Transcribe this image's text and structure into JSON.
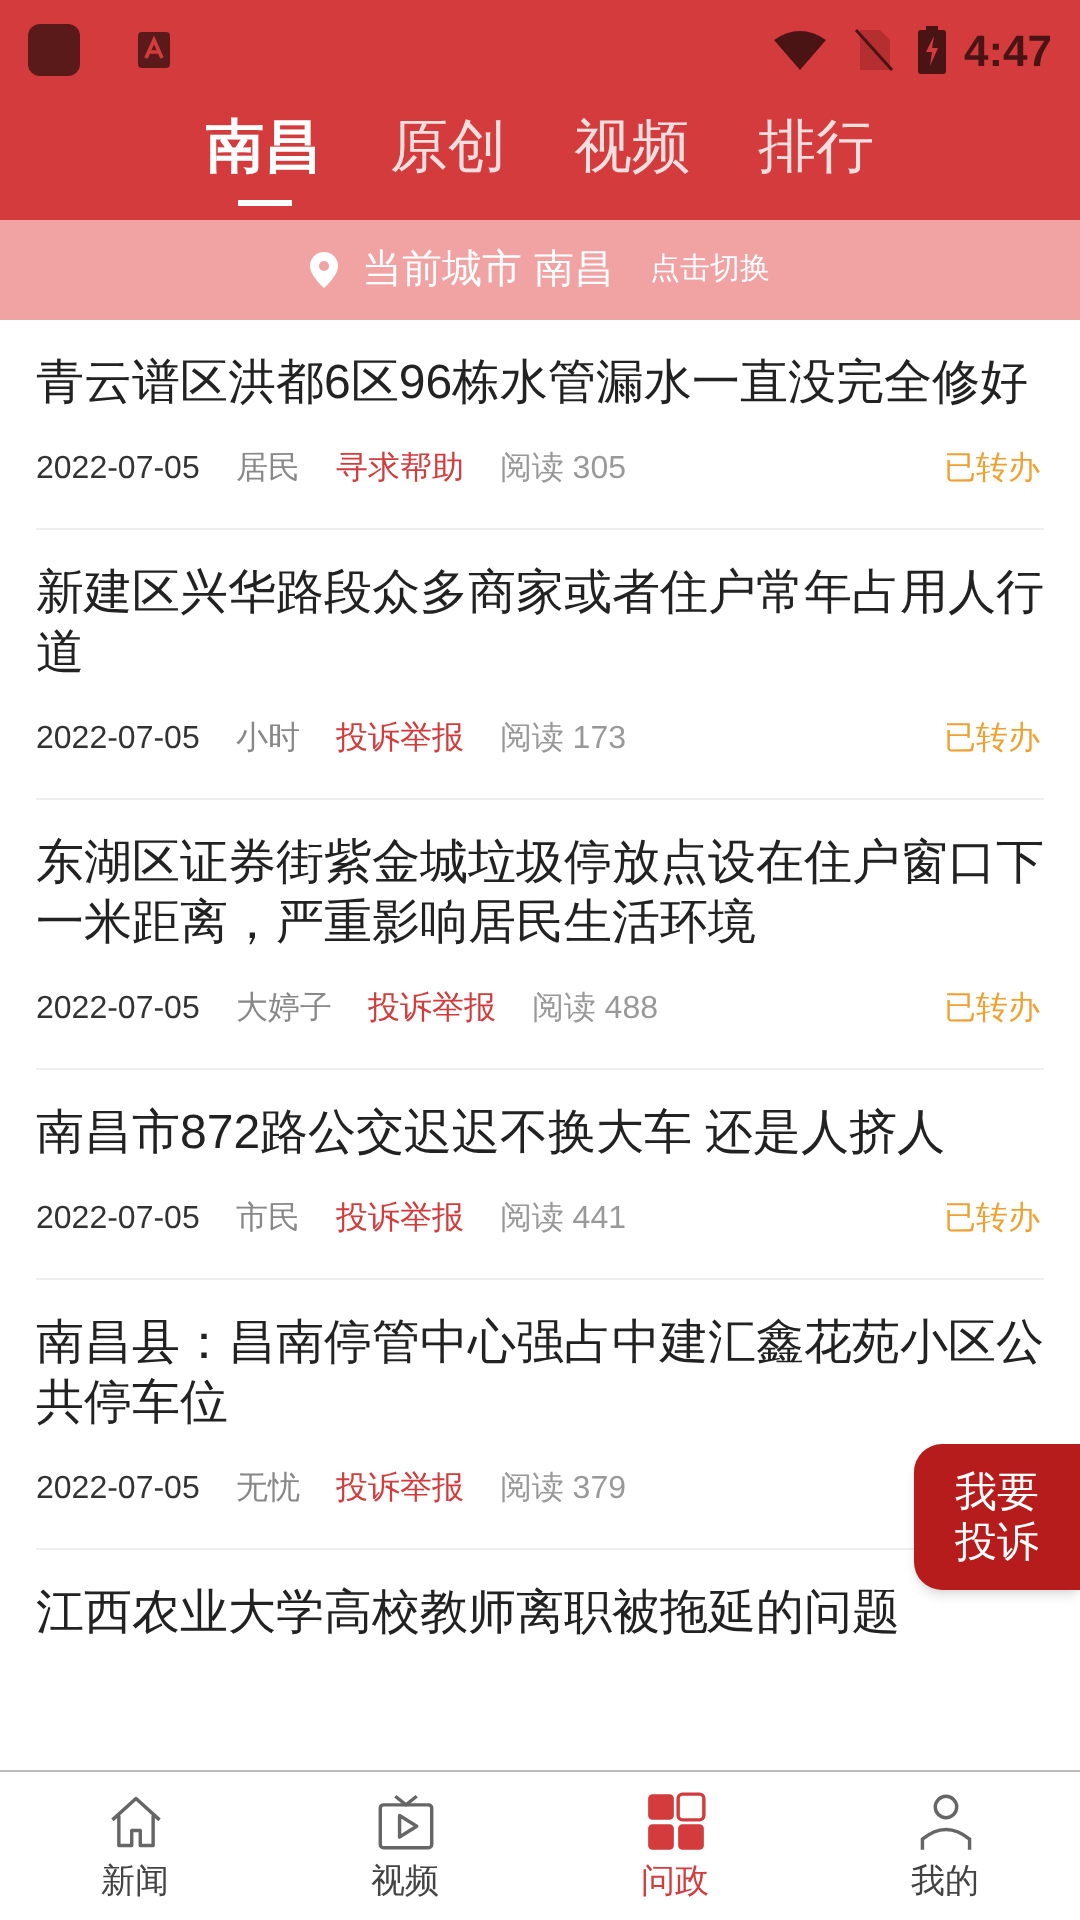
{
  "status_bar": {
    "time": "4:47"
  },
  "tabs": [
    {
      "label": "南昌",
      "selected": true
    },
    {
      "label": "原创",
      "selected": false
    },
    {
      "label": "视频",
      "selected": false
    },
    {
      "label": "排行",
      "selected": false
    }
  ],
  "city_bar": {
    "label": "当前城市 南昌",
    "action": "点击切换"
  },
  "posts": [
    {
      "title": "青云谱区洪都6区96栋水管漏水一直没完全修好",
      "date": "2022-07-05",
      "author": "居民",
      "category": "寻求帮助",
      "reads": "阅读 305",
      "status": "已转办"
    },
    {
      "title": "新建区兴华路段众多商家或者住户常年占用人行道",
      "date": "2022-07-05",
      "author": "小时",
      "category": "投诉举报",
      "reads": "阅读 173",
      "status": "已转办"
    },
    {
      "title": "东湖区证券街紫金城垃圾停放点设在住户窗口下一米距离，严重影响居民生活环境",
      "date": "2022-07-05",
      "author": "大婷子",
      "category": "投诉举报",
      "reads": "阅读 488",
      "status": "已转办"
    },
    {
      "title": "南昌市872路公交迟迟不换大车 还是人挤人",
      "date": "2022-07-05",
      "author": "市民",
      "category": "投诉举报",
      "reads": "阅读 441",
      "status": "已转办"
    },
    {
      "title": "南昌县：昌南停管中心强占中建汇鑫花苑小区公共停车位",
      "date": "2022-07-05",
      "author": "无忧",
      "category": "投诉举报",
      "reads": "阅读 379"
    },
    {
      "title": "江西农业大学高校教师离职被拖延的问题"
    }
  ],
  "float_button": {
    "label": "我要投诉"
  },
  "bottom_nav": [
    {
      "label": "新闻",
      "kind": "home",
      "selected": false
    },
    {
      "label": "视频",
      "kind": "tv",
      "selected": false
    },
    {
      "label": "问政",
      "kind": "grid",
      "selected": true
    },
    {
      "label": "我的",
      "kind": "person",
      "selected": false
    }
  ]
}
